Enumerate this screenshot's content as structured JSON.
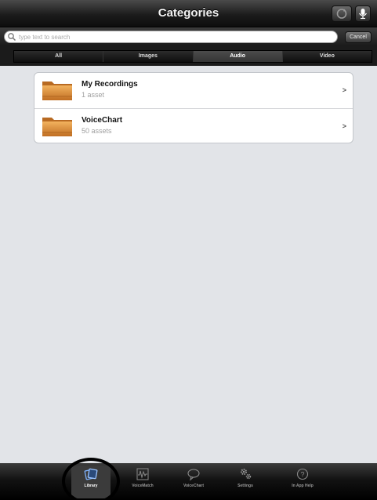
{
  "navbar": {
    "title": "Categories",
    "refresh_icon": "refresh-icon",
    "mic_icon": "microphone-icon"
  },
  "search": {
    "placeholder": "type text to search",
    "value": "",
    "cancel_label": "Cancel"
  },
  "segments": [
    {
      "label": "All",
      "selected": false
    },
    {
      "label": "Images",
      "selected": false
    },
    {
      "label": "Audio",
      "selected": true
    },
    {
      "label": "Video",
      "selected": false
    }
  ],
  "categories": [
    {
      "title": "My Recordings",
      "subtitle": "1 asset",
      "icon": "folder-icon"
    },
    {
      "title": "VoiceChart",
      "subtitle": "50 assets",
      "icon": "folder-icon"
    }
  ],
  "tabs": [
    {
      "label": "Library",
      "icon": "library-icon",
      "selected": true
    },
    {
      "label": "VoiceMatch",
      "icon": "waveform-icon",
      "selected": false
    },
    {
      "label": "VoiceChart",
      "icon": "speech-bubble-icon",
      "selected": false
    },
    {
      "label": "Settings",
      "icon": "gears-icon",
      "selected": false
    },
    {
      "label": "In App Help",
      "icon": "help-icon",
      "selected": false
    }
  ],
  "colors": {
    "content_bg": "#e2e4e8",
    "bar_dark": "#1b1b1b",
    "folder_orange": "#d9893a"
  }
}
